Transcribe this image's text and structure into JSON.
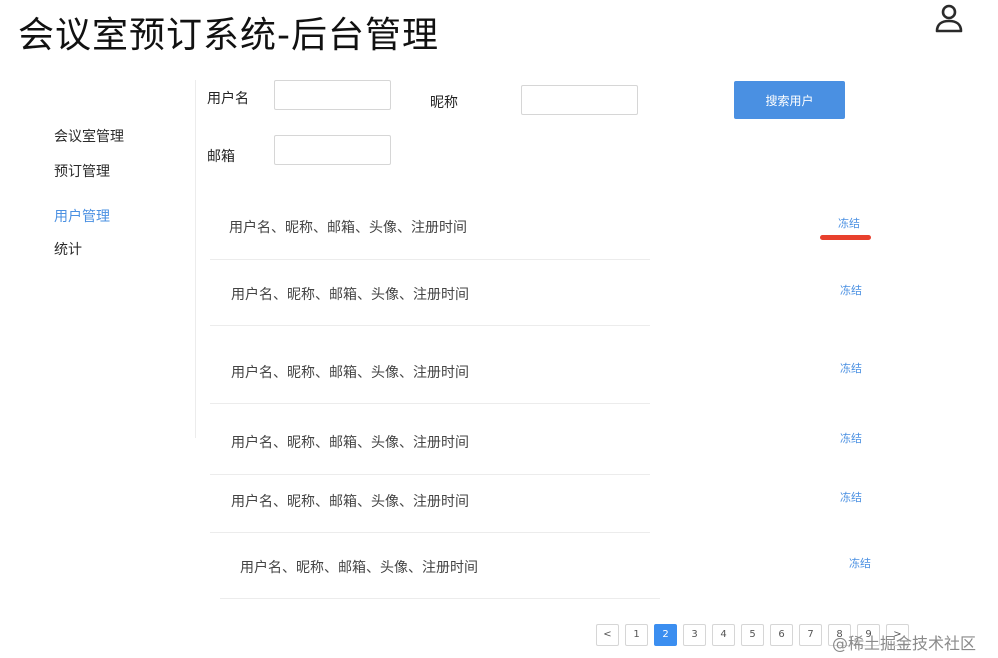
{
  "header": {
    "title": "会议室预订系统-后台管理",
    "user_icon": "user-icon"
  },
  "sidebar": {
    "items": [
      {
        "label": "会议室管理",
        "active": false
      },
      {
        "label": "预订管理",
        "active": false
      },
      {
        "label": "用户管理",
        "active": true
      },
      {
        "label": "统计",
        "active": false
      }
    ]
  },
  "search": {
    "username_label": "用户名",
    "nickname_label": "昵称",
    "email_label": "邮箱",
    "username_value": "",
    "nickname_value": "",
    "email_value": "",
    "button_label": "搜索用户"
  },
  "users": {
    "rows": [
      {
        "info": "用户名、昵称、邮箱、头像、注册时间",
        "action": "冻结"
      },
      {
        "info": "用户名、昵称、邮箱、头像、注册时间",
        "action": "冻结"
      },
      {
        "info": "用户名、昵称、邮箱、头像、注册时间",
        "action": "冻结"
      },
      {
        "info": "用户名、昵称、邮箱、头像、注册时间",
        "action": "冻结"
      },
      {
        "info": "用户名、昵称、邮箱、头像、注册时间",
        "action": "冻结"
      },
      {
        "info": "用户名、昵称、邮箱、头像、注册时间",
        "action": "冻结"
      }
    ]
  },
  "pagination": {
    "prev": "<",
    "pages": [
      "1",
      "2",
      "3",
      "4",
      "5",
      "6",
      "7",
      "8",
      "9"
    ],
    "current": "2",
    "next": ">"
  },
  "watermark": "@稀土掘金技术社区",
  "colors": {
    "accent": "#4a90e2",
    "annotation_red": "#e8402d"
  }
}
